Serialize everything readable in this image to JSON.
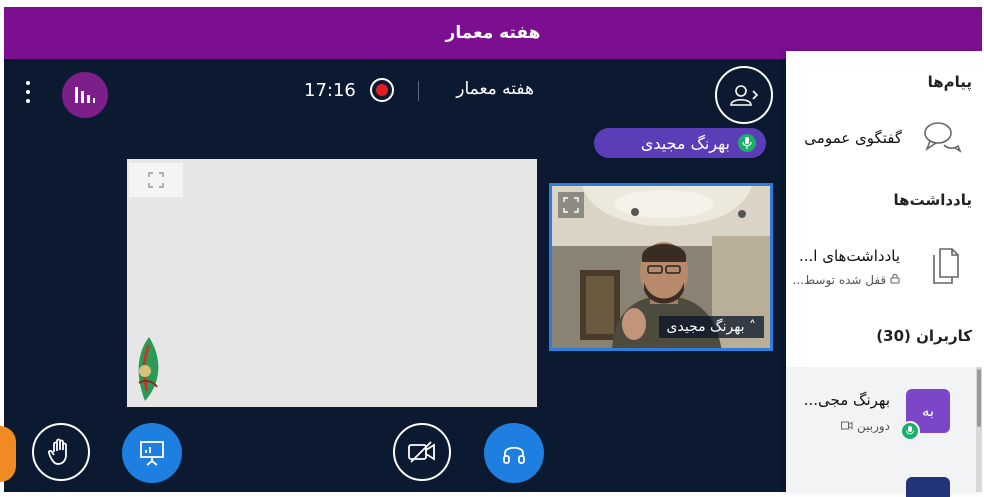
{
  "banner": {
    "title": "هفته معمار"
  },
  "topbar": {
    "clock": "17:16",
    "meeting_name": "هفته معمار"
  },
  "talker": {
    "name": "بهرنگ مجیدی"
  },
  "webcam": {
    "label": "˄ بهرنگ مجیدی"
  },
  "panel": {
    "messages_heading": "پیام‌ها",
    "public_chat_label": "گفتگوی عمومی",
    "notes_heading": "یادداشت‌ها",
    "shared_notes_label": "یادداشت‌های ا...",
    "shared_notes_status": "قفل شده توسط...",
    "users_heading": "کاربران (30)",
    "user": {
      "avatar_text": "به",
      "name": "بهرنگ مجی...",
      "status": "دوربین"
    }
  },
  "colors": {
    "banner": "#7b0f8f",
    "stage": "#0b1a30",
    "accent_blue": "#1f7fe0",
    "talker_bg": "#5b3db8",
    "mic_green": "#1aaf6a",
    "record_red": "#e02020"
  },
  "icons": {
    "options": "kebab-icon",
    "stats": "bar-chart-icon",
    "record": "record-icon",
    "users_toggle": "user-icon",
    "mic": "mic-icon",
    "expand": "expand-icon",
    "raise_hand": "hand-icon",
    "presentation": "presentation-icon",
    "video_off": "video-off-icon",
    "audio": "headphones-icon",
    "chat": "chat-icon",
    "notes": "document-icon",
    "lock": "lock-icon",
    "camera": "camera-icon"
  }
}
